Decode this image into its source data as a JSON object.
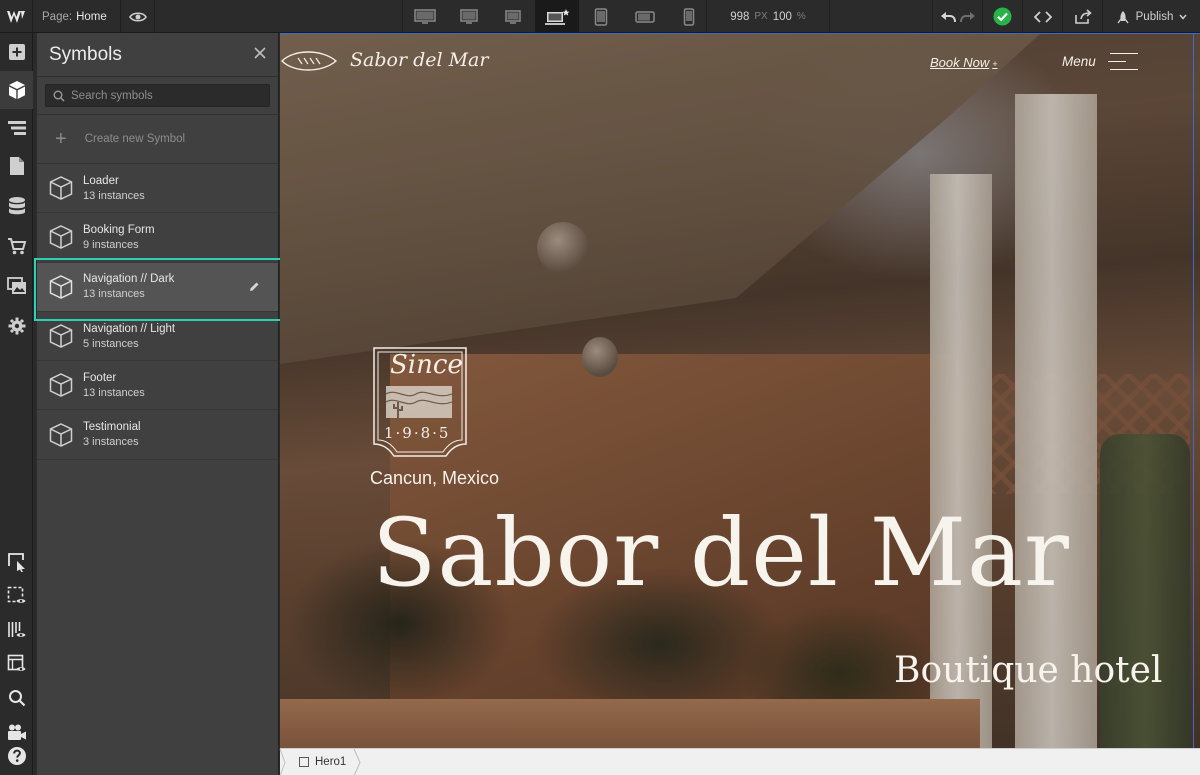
{
  "topbar": {
    "page_label": "Page:",
    "page_name": "Home",
    "width_value": "998",
    "width_unit": "PX",
    "zoom_value": "100",
    "zoom_unit": "%",
    "publish_label": "Publish",
    "status_color": "#27b24a"
  },
  "symbols_panel": {
    "title": "Symbols",
    "search_placeholder": "Search symbols",
    "create_label": "Create new Symbol",
    "items": [
      {
        "name": "Loader",
        "count": "13 instances"
      },
      {
        "name": "Booking Form",
        "count": "9 instances"
      },
      {
        "name": "Navigation // Dark",
        "count": "13 instances"
      },
      {
        "name": "Navigation // Light",
        "count": "5 instances"
      },
      {
        "name": "Footer",
        "count": "13 instances"
      },
      {
        "name": "Testimonial",
        "count": "3 instances"
      }
    ],
    "selected_index": 2,
    "highlight_color": "#2bd1b5"
  },
  "canvas": {
    "nav": {
      "brand": "Sabor del Mar",
      "book_now": "Book Now",
      "book_now_mark": "+",
      "menu": "Menu"
    },
    "badge": {
      "script": "Since",
      "year": "1·9·8·5"
    },
    "location": "Cancun, Mexico",
    "title": "Sabor del Mar",
    "subtitle": "Boutique hotel"
  },
  "breadcrumb": {
    "element": "Hero1"
  }
}
